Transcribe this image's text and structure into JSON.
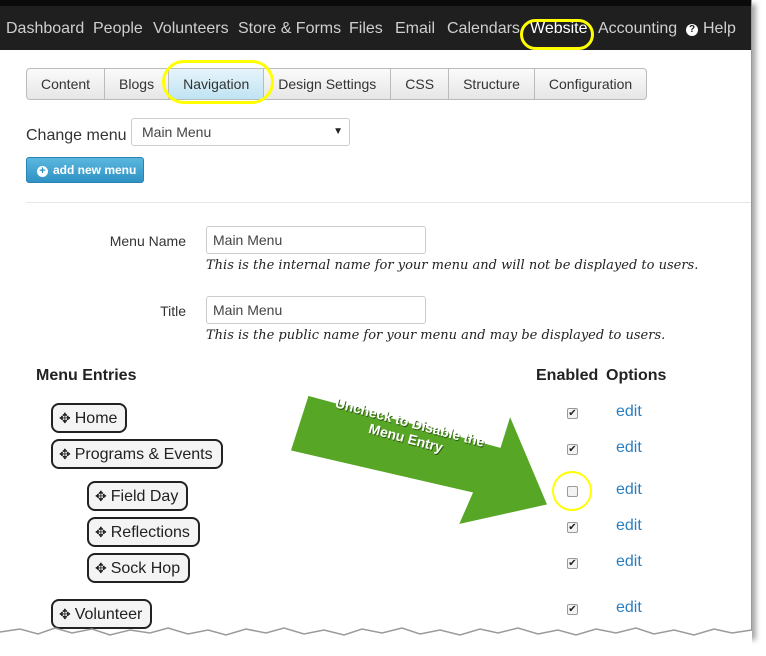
{
  "topnav": {
    "items": [
      "Dashboard",
      "People",
      "Volunteers",
      "Store & Forms",
      "Files",
      "Email",
      "Calendars",
      "Website",
      "Accounting",
      "Help"
    ]
  },
  "tabs": [
    "Content",
    "Blogs",
    "Navigation",
    "Design Settings",
    "CSS",
    "Structure",
    "Configuration"
  ],
  "change_menu": {
    "label": "Change menu",
    "selected": "Main Menu"
  },
  "add_menu_button": "add new menu",
  "form": {
    "menu_name_label": "Menu Name",
    "menu_name_value": "Main Menu",
    "menu_name_help": "This is the internal name for your menu and will not be displayed to users.",
    "title_label": "Title",
    "title_value": "Main Menu",
    "title_help": "This is the public name for your menu and may be displayed to users."
  },
  "entries_header": {
    "entries": "Menu Entries",
    "enabled": "Enabled",
    "options": "Options"
  },
  "entries": [
    {
      "label": "Home",
      "enabled": true,
      "option": "edit"
    },
    {
      "label": "Programs & Events",
      "enabled": true,
      "option": "edit"
    },
    {
      "label": "Field Day",
      "enabled": false,
      "option": "edit"
    },
    {
      "label": "Reflections",
      "enabled": true,
      "option": "edit"
    },
    {
      "label": "Sock Hop",
      "enabled": true,
      "option": "edit"
    },
    {
      "label": "Volunteer",
      "enabled": true,
      "option": "edit"
    }
  ],
  "callout": {
    "text": "Uncheck to Disable the Menu Entry",
    "color": "#58a626"
  },
  "highlight_color": "#ffff00",
  "accent_color": "#2a7fc0"
}
